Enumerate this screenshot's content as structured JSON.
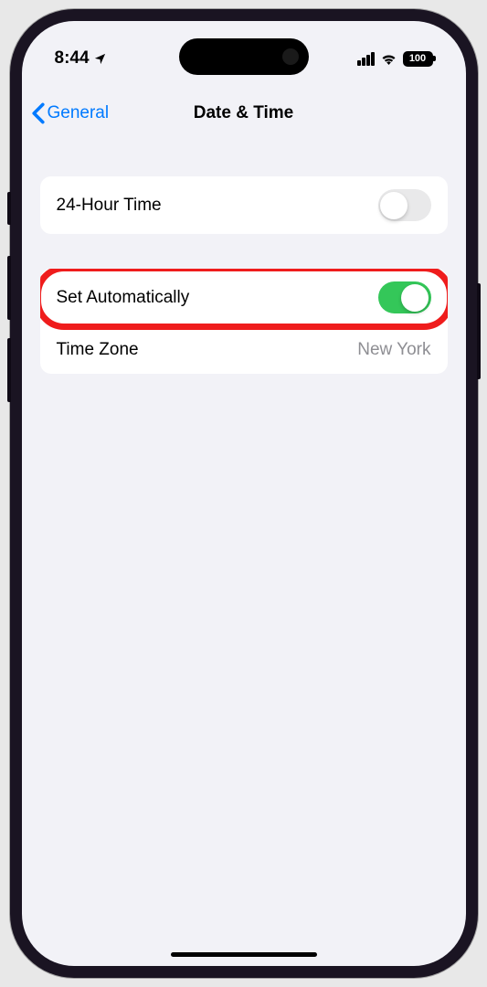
{
  "status": {
    "time": "8:44",
    "battery": "100"
  },
  "nav": {
    "back_label": "General",
    "title": "Date & Time"
  },
  "group1": {
    "row0": {
      "label": "24-Hour Time"
    }
  },
  "group2": {
    "row0": {
      "label": "Set Automatically"
    },
    "row1": {
      "label": "Time Zone",
      "value": "New York"
    }
  }
}
